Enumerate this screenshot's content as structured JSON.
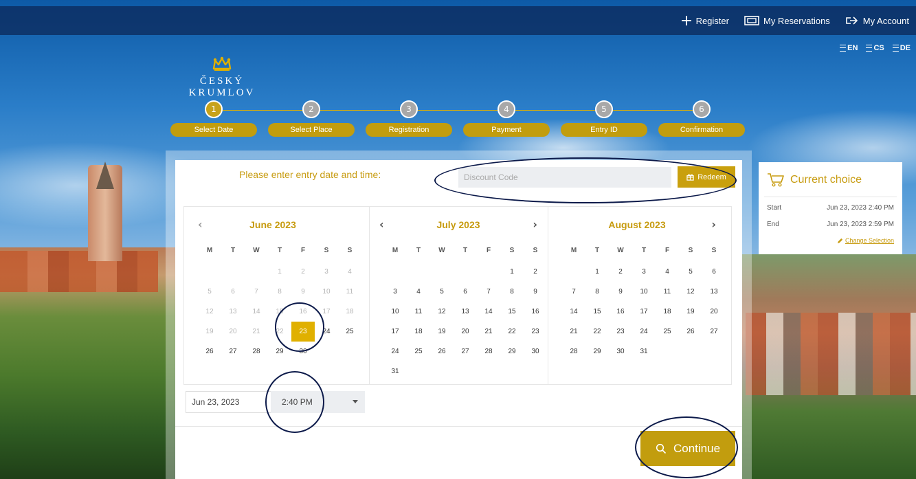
{
  "nav": {
    "register": "Register",
    "reservations": "My Reservations",
    "account": "My Account"
  },
  "languages": [
    "EN",
    "CS",
    "DE"
  ],
  "logo": {
    "name": "ČESKÝ KRUMLOV"
  },
  "steps": [
    {
      "num": "1",
      "label": "Select Date",
      "active": true
    },
    {
      "num": "2",
      "label": "Select Place",
      "active": false
    },
    {
      "num": "3",
      "label": "Registration",
      "active": false
    },
    {
      "num": "4",
      "label": "Payment",
      "active": false
    },
    {
      "num": "5",
      "label": "Entry ID",
      "active": false
    },
    {
      "num": "6",
      "label": "Confirmation",
      "active": false
    }
  ],
  "form": {
    "prompt": "Please enter entry date and time:",
    "discount_placeholder": "Discount Code",
    "redeem_label": "Redeem",
    "date_value": "Jun 23, 2023",
    "time_value": "2:40 PM",
    "continue_label": "Continue"
  },
  "calendar": {
    "weekdays": [
      "M",
      "T",
      "W",
      "T",
      "F",
      "S",
      "S"
    ],
    "months": [
      {
        "title": "June 2023",
        "offset": 3,
        "days": 30,
        "disabled_until": 22,
        "selected": 23
      },
      {
        "title": "July 2023",
        "offset": 5,
        "days": 31,
        "disabled_until": 0,
        "selected": 0
      },
      {
        "title": "August 2023",
        "offset": 1,
        "days": 31,
        "disabled_until": 0,
        "selected": 0
      }
    ]
  },
  "choice": {
    "title": "Current choice",
    "start_label": "Start",
    "start_value": "Jun 23, 2023 2:40 PM",
    "end_label": "End",
    "end_value": "Jun 23, 2023 2:59 PM",
    "change_label": "Change Selection"
  },
  "colors": {
    "accent": "#c29d0e",
    "selected_day": "#e0b000",
    "topbar": "#0c285a"
  }
}
